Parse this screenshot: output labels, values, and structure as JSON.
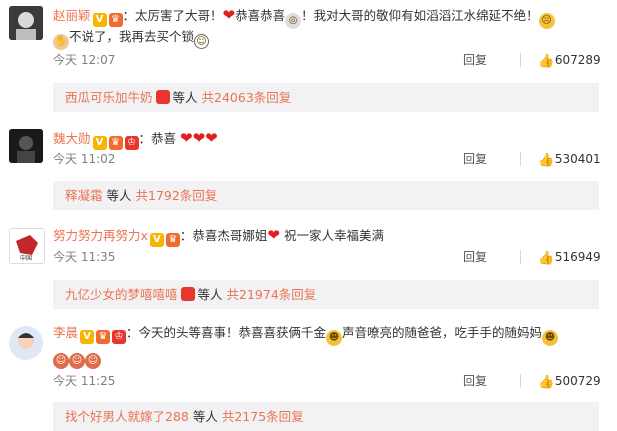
{
  "comments": [
    {
      "username": "赵丽颖",
      "text_a": "：太厉害了大哥！",
      "text_b": "恭喜恭喜",
      "text_c": "！我对大哥的敬仰有如滔滔江水绵延不绝！",
      "text_d": "不说了，我再去买个锁",
      "time": "今天 12:07",
      "reply_label": "回复",
      "likes": "607289",
      "sub_name": "西瓜可乐加牛奶",
      "sub_mid": "等人",
      "sub_count": "共24063条回复"
    },
    {
      "username": "魏大勋",
      "text_a": "：恭喜",
      "time": "今天 11:02",
      "reply_label": "回复",
      "likes": "530401",
      "sub_name": "释凝霜",
      "sub_mid": "等人",
      "sub_count": "共1792条回复"
    },
    {
      "username": "努力努力再努力x",
      "text_a": "：恭喜杰哥娜姐",
      "text_b": "祝一家人幸福美满",
      "time": "今天 11:35",
      "reply_label": "回复",
      "likes": "516949",
      "sub_name": "九亿少女的梦嘻嘻嘻",
      "sub_mid": "等人",
      "sub_count": "共21974条回复"
    },
    {
      "username": "李晨",
      "text_a": "：今天的头等喜事！恭喜喜获俩千金",
      "text_b": "声音嘹亮的随爸爸，吃手手的随妈妈",
      "time": "今天 11:25",
      "reply_label": "回复",
      "likes": "500729",
      "sub_name": "找个好男人就嫁了288",
      "sub_mid": "等人",
      "sub_count": "共2175条回复"
    }
  ],
  "colors": {
    "accent": "#eb7350",
    "subbox_bg": "#f2f2f5",
    "heart": "#e0201f"
  }
}
